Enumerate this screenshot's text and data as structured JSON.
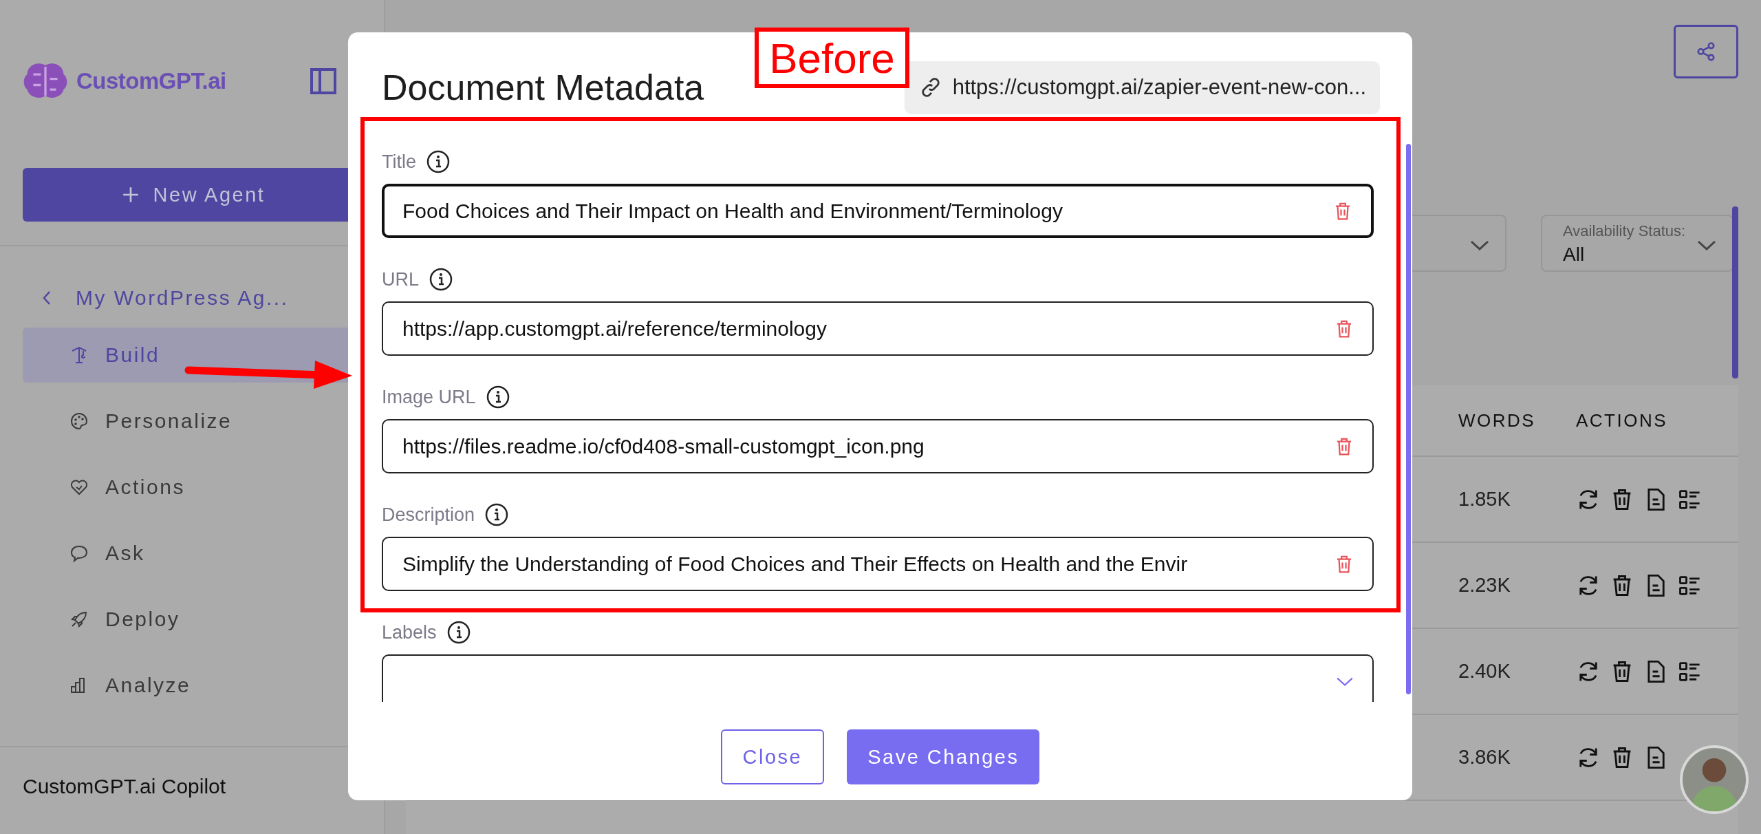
{
  "sidebar": {
    "logo": "CustomGPT.ai",
    "new_agent_button": "New Agent",
    "back_link": "My WordPress Ag...",
    "nav_items": [
      {
        "label": "Build",
        "selected": true
      },
      {
        "label": "Personalize",
        "selected": false
      },
      {
        "label": "Actions",
        "selected": false
      },
      {
        "label": "Ask",
        "selected": false
      },
      {
        "label": "Deploy",
        "selected": false
      },
      {
        "label": "Analyze",
        "selected": false
      }
    ],
    "footer": "CustomGPT.ai Copilot"
  },
  "filters": [
    {
      "label": "Availability Status:",
      "value": "All"
    }
  ],
  "table": {
    "columns": [
      "WORDS",
      "ACTIONS"
    ],
    "rows": [
      {
        "words": "1.85K"
      },
      {
        "words": "2.23K"
      },
      {
        "words": "2.40K"
      },
      {
        "words": "3.86K"
      }
    ]
  },
  "modal": {
    "title": "Document Metadata",
    "source_url": "https://customgpt.ai/zapier-event-new-con...",
    "fields": [
      {
        "kind": "text",
        "label": "Title",
        "value": "Food Choices and Their Impact on Health and Environment/Terminology",
        "focused": true
      },
      {
        "kind": "text",
        "label": "URL",
        "value": "https://app.customgpt.ai/reference/terminology",
        "focused": false
      },
      {
        "kind": "text",
        "label": "Image URL",
        "value": "https://files.readme.io/cf0d408-small-customgpt_icon.png",
        "focused": false
      },
      {
        "kind": "text",
        "label": "Description",
        "value": "Simplify the Understanding of Food Choices and Their Effects on Health and the Envir",
        "focused": false
      },
      {
        "kind": "select",
        "label": "Labels",
        "focused": false
      }
    ],
    "buttons": [
      {
        "kind": "secondary",
        "label": "Close"
      },
      {
        "kind": "primary",
        "label": "Save Changes"
      }
    ]
  },
  "annotation": {
    "label": "Before"
  }
}
